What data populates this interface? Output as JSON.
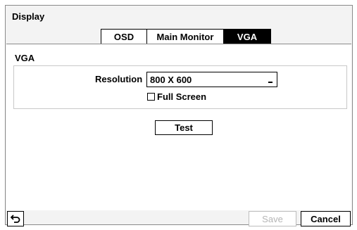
{
  "window": {
    "title": "Display"
  },
  "tabs": [
    {
      "label": "OSD",
      "active": false
    },
    {
      "label": "Main Monitor",
      "active": false
    },
    {
      "label": "VGA",
      "active": true
    }
  ],
  "vga": {
    "section_label": "VGA",
    "resolution_label": "Resolution",
    "resolution_value": "800 X 600",
    "full_screen_label": "Full Screen",
    "full_screen_checked": false,
    "test_label": "Test"
  },
  "footer": {
    "back_icon": "return-arrow-icon",
    "save_label": "Save",
    "save_enabled": false,
    "cancel_label": "Cancel"
  },
  "colors": {
    "active_tab_bg": "#000000",
    "active_tab_text": "#ffffff",
    "disabled_text": "#b5b5b5",
    "window_bg": "#f3f3f3"
  }
}
